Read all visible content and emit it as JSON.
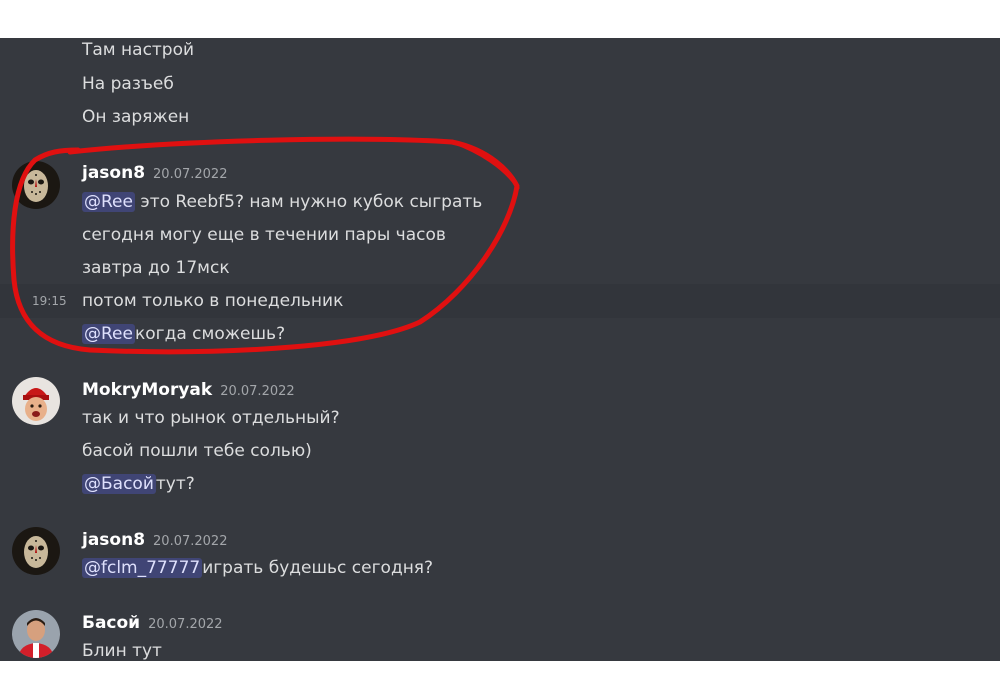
{
  "continuation_lines": [
    "Там настрой",
    "На разъеб",
    "Он заряжен"
  ],
  "messages": [
    {
      "author": "jason8",
      "timestamp": "20.07.2022",
      "avatar_icon": "hockey-mask-avatar",
      "lines": [
        {
          "mention": "@Ree",
          "text": " это Reebf5? нам нужно кубок сыграть"
        },
        {
          "text": "сегодня могу еще в течении пары часов"
        },
        {
          "text": "завтра до 17мск"
        },
        {
          "text": "потом только в понедельник",
          "hover_time": "19:15"
        },
        {
          "mention": "@Ree",
          "text": "когда сможешь?"
        }
      ]
    },
    {
      "author": "MokryMoryak",
      "timestamp": "20.07.2022",
      "avatar_icon": "red-hat-face-avatar",
      "lines": [
        {
          "text": "так и что рынок отдельный?"
        },
        {
          "text": "басой пошли тебе солью)"
        },
        {
          "mention": "@Басой",
          "text": "тут?"
        }
      ]
    },
    {
      "author": "jason8",
      "timestamp": "20.07.2022",
      "avatar_icon": "hockey-mask-avatar",
      "lines": [
        {
          "mention": "@fclm_77777",
          "text": "играть будешьс сегодня?"
        }
      ]
    },
    {
      "author": "Басой",
      "timestamp": "20.07.2022",
      "avatar_icon": "footballer-photo-avatar",
      "lines": [
        {
          "text": "Блин тут"
        }
      ]
    }
  ],
  "colors": {
    "background": "#36393f",
    "text": "#dcddde",
    "username": "#ffffff",
    "timestamp": "#a3a6aa",
    "mention_bg": "#4e559c",
    "annotation": "#e01010"
  }
}
